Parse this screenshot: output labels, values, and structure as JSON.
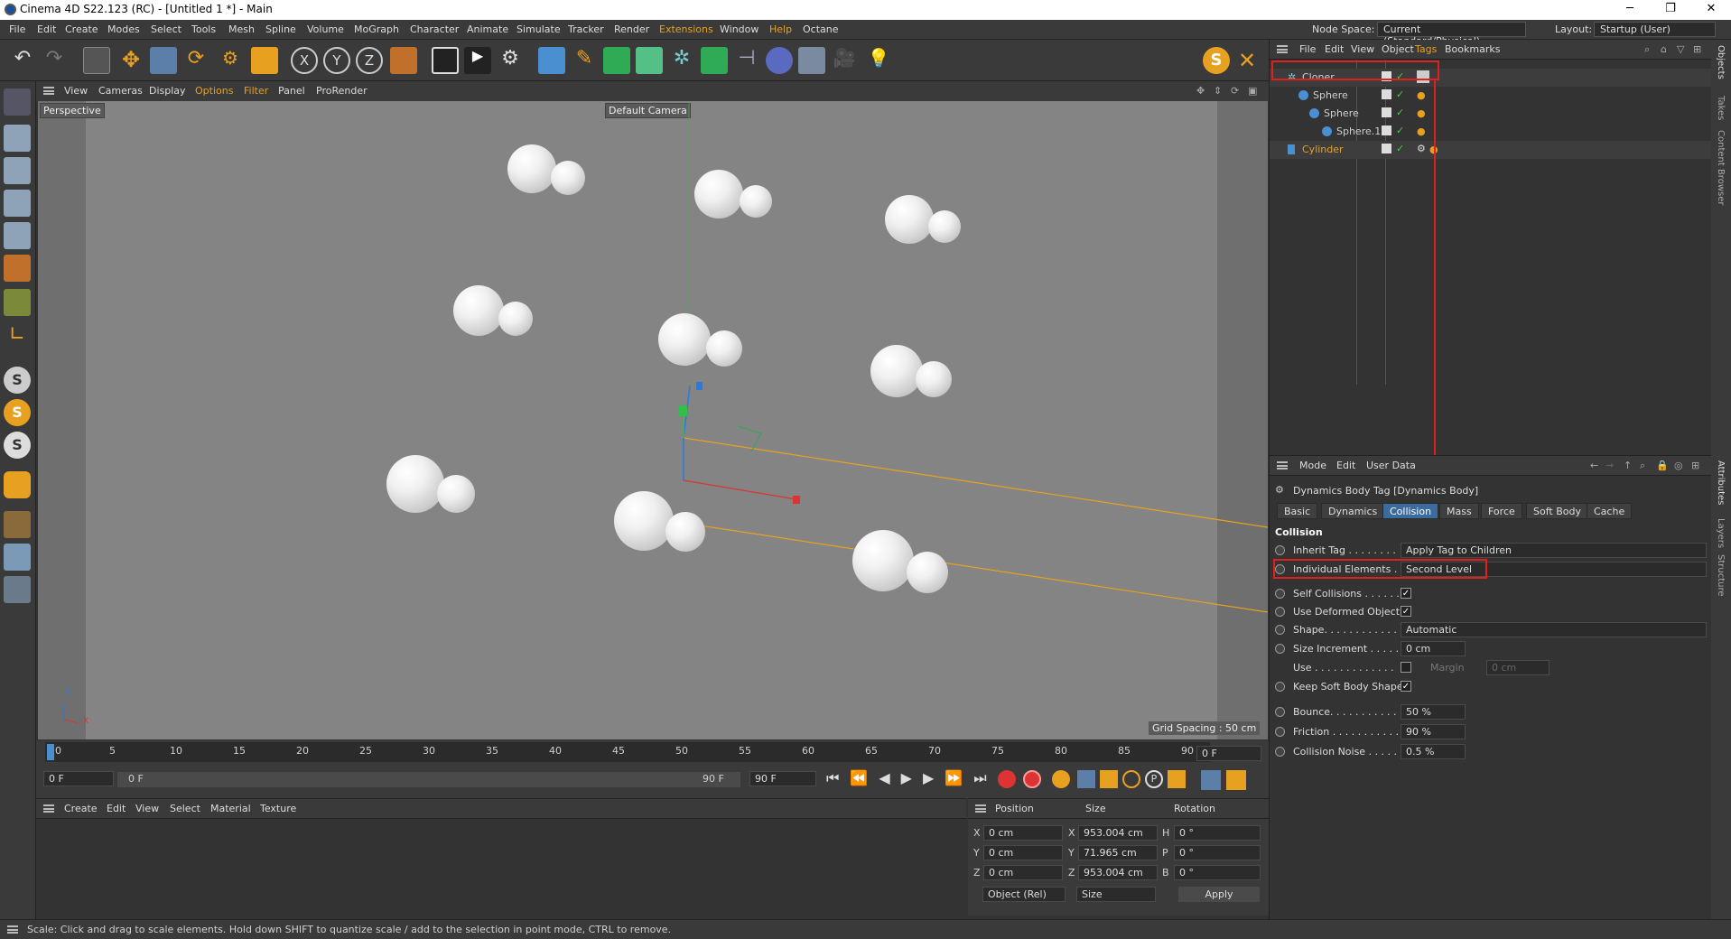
{
  "window": {
    "title": "Cinema 4D S22.123 (RC) - [Untitled 1 *] - Main",
    "minimize": "─",
    "restore": "❐",
    "close": "✕"
  },
  "menubar": {
    "items": [
      "File",
      "Edit",
      "Create",
      "Modes",
      "Select",
      "Tools",
      "Mesh",
      "Spline",
      "Volume",
      "MoGraph",
      "Character",
      "Animate",
      "Simulate",
      "Tracker",
      "Render",
      "Extensions",
      "Window",
      "Help",
      "Octane"
    ],
    "node_space_label": "Node Space:",
    "node_space_value": "Current (Standard/Physical)",
    "layout_label": "Layout:",
    "layout_value": "Startup (User)"
  },
  "viewport": {
    "menu": [
      "View",
      "Cameras",
      "Display",
      "Options",
      "Filter",
      "Panel",
      "ProRender"
    ],
    "view_name": "Perspective",
    "camera_name": "Default Camera",
    "grid_spacing": "Grid Spacing : 50 cm",
    "axis_y": "Y",
    "axis_x": "X"
  },
  "timeline": {
    "ticks": [
      "0",
      "5",
      "10",
      "15",
      "20",
      "25",
      "30",
      "35",
      "40",
      "45",
      "50",
      "55",
      "60",
      "65",
      "70",
      "75",
      "80",
      "85",
      "90"
    ],
    "current_frame": "0 F",
    "start_field": "0 F",
    "range_start": "0 F",
    "range_end": "90 F",
    "end_field": "90 F"
  },
  "material_manager": {
    "menu": [
      "Create",
      "Edit",
      "View",
      "Select",
      "Material",
      "Texture"
    ]
  },
  "coordinates": {
    "headers": [
      "Position",
      "Size",
      "Rotation"
    ],
    "rows": [
      {
        "axis": "X",
        "pos": "0 cm",
        "size_axis": "X",
        "size": "953.004 cm",
        "rot_axis": "H",
        "rot": "0 °"
      },
      {
        "axis": "Y",
        "pos": "0 cm",
        "size_axis": "Y",
        "size": "71.965 cm",
        "rot_axis": "P",
        "rot": "0 °"
      },
      {
        "axis": "Z",
        "pos": "0 cm",
        "size_axis": "Z",
        "size": "953.004 cm",
        "rot_axis": "B",
        "rot": "0 °"
      }
    ],
    "mode_select": "Object (Rel)",
    "size_select": "Size",
    "apply": "Apply"
  },
  "status": "Scale: Click and drag to scale elements. Hold down SHIFT to quantize scale / add to the selection in point mode, CTRL to remove.",
  "object_manager": {
    "menu": [
      "File",
      "Edit",
      "View",
      "Object",
      "Tags",
      "Bookmarks"
    ],
    "objects": [
      {
        "name": "Cloner",
        "color": "#d0d0d0"
      },
      {
        "name": "Sphere",
        "color": "#d0d0d0"
      },
      {
        "name": "Sphere",
        "color": "#d0d0d0"
      },
      {
        "name": "Sphere.1",
        "color": "#d0d0d0"
      },
      {
        "name": "Cylinder",
        "color": "#e8a020"
      }
    ]
  },
  "attributes": {
    "menu": [
      "Mode",
      "Edit",
      "User Data"
    ],
    "tag_title": "Dynamics Body Tag [Dynamics Body]",
    "tabs": [
      "Basic",
      "Dynamics",
      "Collision",
      "Mass",
      "Force",
      "Soft Body",
      "Cache"
    ],
    "active_tab": "Collision",
    "section": "Collision",
    "inherit_tag_label": "Inherit Tag . . . . . . . .",
    "inherit_tag_value": "Apply Tag to Children",
    "individual_label": "Individual Elements . .",
    "individual_value": "Second Level",
    "self_collisions_label": "Self Collisions . . . . . .",
    "use_deformed_label": "Use Deformed Object",
    "shape_label": "Shape. . . . . . . . . . . .",
    "shape_value": "Automatic",
    "size_increment_label": "Size Increment . . . . .",
    "size_increment_value": "0 cm",
    "use_label": "Use . . . . . . . . . . . . .",
    "margin_label": "Margin",
    "margin_value": "0 cm",
    "keep_soft_label": "Keep Soft Body Shape",
    "bounce_label": "Bounce. . . . . . . . . . .",
    "bounce_value": "50 %",
    "friction_label": "Friction . . . . . . . . . . .",
    "friction_value": "90 %",
    "collision_noise_label": "Collision Noise . . . . .",
    "collision_noise_value": "0.5 %",
    "check_mark": "✓"
  },
  "right_strip": [
    "Objects",
    "Takes",
    "Content Browser",
    "Attributes",
    "Layers",
    "Structure"
  ]
}
